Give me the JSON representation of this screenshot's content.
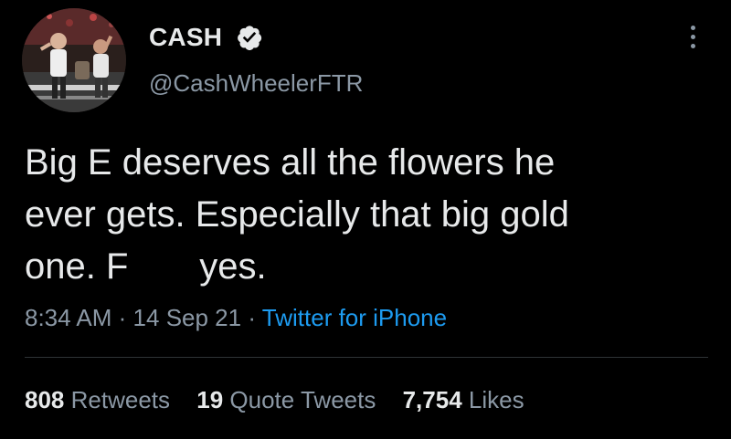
{
  "author": {
    "display_name": "CASH",
    "handle": "@CashWheelerFTR",
    "verified_icon": "verified-badge-icon",
    "avatar": "profile-photo"
  },
  "tweet": {
    "lines": [
      "Big E deserves all the flowers he",
      "ever gets. Especially that big gold",
      "one. F       yes."
    ],
    "time": "8:34 AM",
    "date": "14 Sep 21",
    "separator": "·",
    "source": "Twitter for iPhone"
  },
  "stats": {
    "retweets_count": "808",
    "retweets_label": "Retweets",
    "quotes_count": "19",
    "quotes_label": "Quote Tweets",
    "likes_count": "7,754",
    "likes_label": "Likes"
  },
  "colors": {
    "background": "#000000",
    "text_primary": "#e7e9ea",
    "text_secondary": "#8b98a5",
    "link": "#1d9bf0",
    "divider": "#2f3336"
  }
}
